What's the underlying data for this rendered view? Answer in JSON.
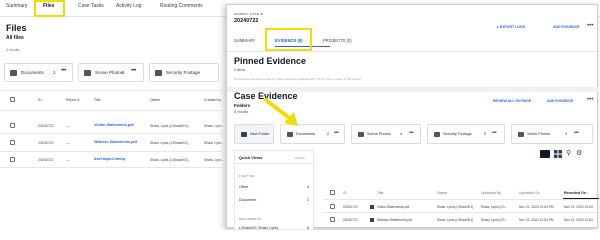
{
  "background": {
    "tabs": [
      "Summary",
      "Files",
      "Case Tasks",
      "Activity Log",
      "Routing Comments"
    ],
    "title": "Files",
    "subtitle": "All files",
    "count": "3 results",
    "folders": [
      {
        "label": "Documents",
        "count": "2"
      },
      {
        "label": "Scene Photos",
        "count": "4"
      },
      {
        "label": "Security Footage",
        "count": "5"
      }
    ],
    "table_headers": [
      "ID",
      "Report #",
      "Title",
      "Owner",
      "Created by"
    ],
    "rows": [
      {
        "id": "20240722",
        "report": "—",
        "title": "Victim Statements.pdf",
        "owner": "Shaw, Lynis (LShaw001)",
        "created": "Shaw, Lyni..."
      },
      {
        "id": "20240722",
        "report": "—",
        "title": "Witness Statements.pdf",
        "owner": "Shaw, Lynis (LShaw001)",
        "created": "Shaw, Lyni..."
      },
      {
        "id": "20240722",
        "report": "—",
        "title": "dscf-tape-2.webp",
        "owner": "Shaw, Lynis (LShaw001)",
        "created": "Shaw, Lyni..."
      }
    ]
  },
  "foreground": {
    "case_label": "PRIMARY CASE ID",
    "case_number": "20240722",
    "export_link": "EXPORT LOGS",
    "add_evidence": "ADD EVIDENCE",
    "tabs": [
      "SUMMARY",
      "EVIDENCE (6)",
      "PROJECTS (0)"
    ],
    "pinned_title": "Pinned Evidence",
    "pinned_items": "0 items",
    "pinned_empty": "No evidence has been pinned yet. When reviewing evidence click \"Pin to Case\" to add it to this section.",
    "case_evidence_title": "Case Evidence",
    "review_all": "REVIEW ALL ON PAGE",
    "add_evidence_2": "ADD EVIDENCE",
    "folders_label": "Folders",
    "results": "6 results",
    "new_folder": "New Folder",
    "folders": [
      {
        "label": "Documents",
        "count": "2"
      },
      {
        "label": "Scene Photos",
        "count": "4"
      },
      {
        "label": "Security Footage",
        "count": "5"
      },
      {
        "label": "Victim Photos",
        "count": "3"
      }
    ],
    "quick_views": {
      "title": "Quick Views",
      "reset": "RESET",
      "sections": [
        {
          "label": "FILE TYPE",
          "items": [
            {
              "label": "Other",
              "count": "4"
            },
            {
              "label": "Document",
              "count": "2"
            }
          ]
        },
        {
          "label": "RECORDED BY",
          "items": [
            {
              "label": "LShaw001 Shaw, Lynis",
              "count": "6"
            }
          ]
        }
      ]
    },
    "table_headers": [
      "ID",
      "Title",
      "Owner",
      "Uploaded By",
      "Uploaded On",
      "Recorded On ↓"
    ],
    "rows": [
      {
        "id": "20240722",
        "title": "Victim-Statements.pdf",
        "owner": "Shaw, Lynis (LShaw001)",
        "uploaded_by": "Shaw, Lynis (LS...",
        "uploaded_on": "Nov 22, 2024 12:54 PM",
        "recorded_on": "Nov 22, 2024 12:54"
      },
      {
        "id": "20240722",
        "title": "Witness-Statements.pdf",
        "owner": "Shaw, Lynis (LShaw001)",
        "uploaded_by": "Shaw, Lynis (LS...",
        "uploaded_on": "Nov 22, 2024 12:54 PM",
        "recorded_on": "Nov 22, 2024 12:54"
      }
    ]
  },
  "colors": {
    "highlight": "#f3dd00",
    "accent": "#2563eb"
  },
  "icons": [
    "folder-icon",
    "more-icon",
    "list-view-icon",
    "grid-view-icon",
    "map-pin-icon",
    "gear-icon",
    "file-icon",
    "arrow-icon"
  ]
}
